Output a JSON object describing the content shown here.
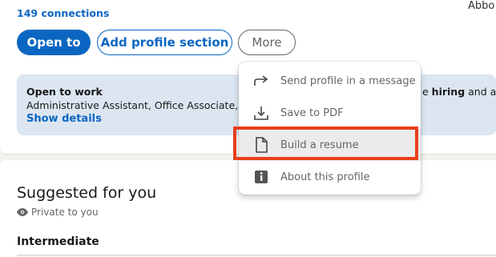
{
  "profile": {
    "connections": "149 connections",
    "top_right_text": "Abbo"
  },
  "actions": {
    "open_to": "Open to",
    "add_section": "Add profile section",
    "more": "More"
  },
  "open_to_work": {
    "title": "Open to work",
    "description": "Administrative Assistant, Office Associate, S",
    "show_details": "Show details",
    "right_prefix": "e ",
    "right_bold": "hiring",
    "right_suffix": " and attr"
  },
  "suggested": {
    "title": "Suggested for you",
    "private": "Private to you",
    "level": "Intermediate"
  },
  "more_menu": {
    "items": [
      {
        "label": "Send profile in a message",
        "icon": "share-arrow-icon"
      },
      {
        "label": "Save to PDF",
        "icon": "download-icon"
      },
      {
        "label": "Build a resume",
        "icon": "document-icon"
      },
      {
        "label": "About this profile",
        "icon": "info-icon"
      }
    ],
    "highlighted_index": 2
  },
  "colors": {
    "brand_blue": "#0a66c2",
    "highlight_red": "#e8401c"
  }
}
